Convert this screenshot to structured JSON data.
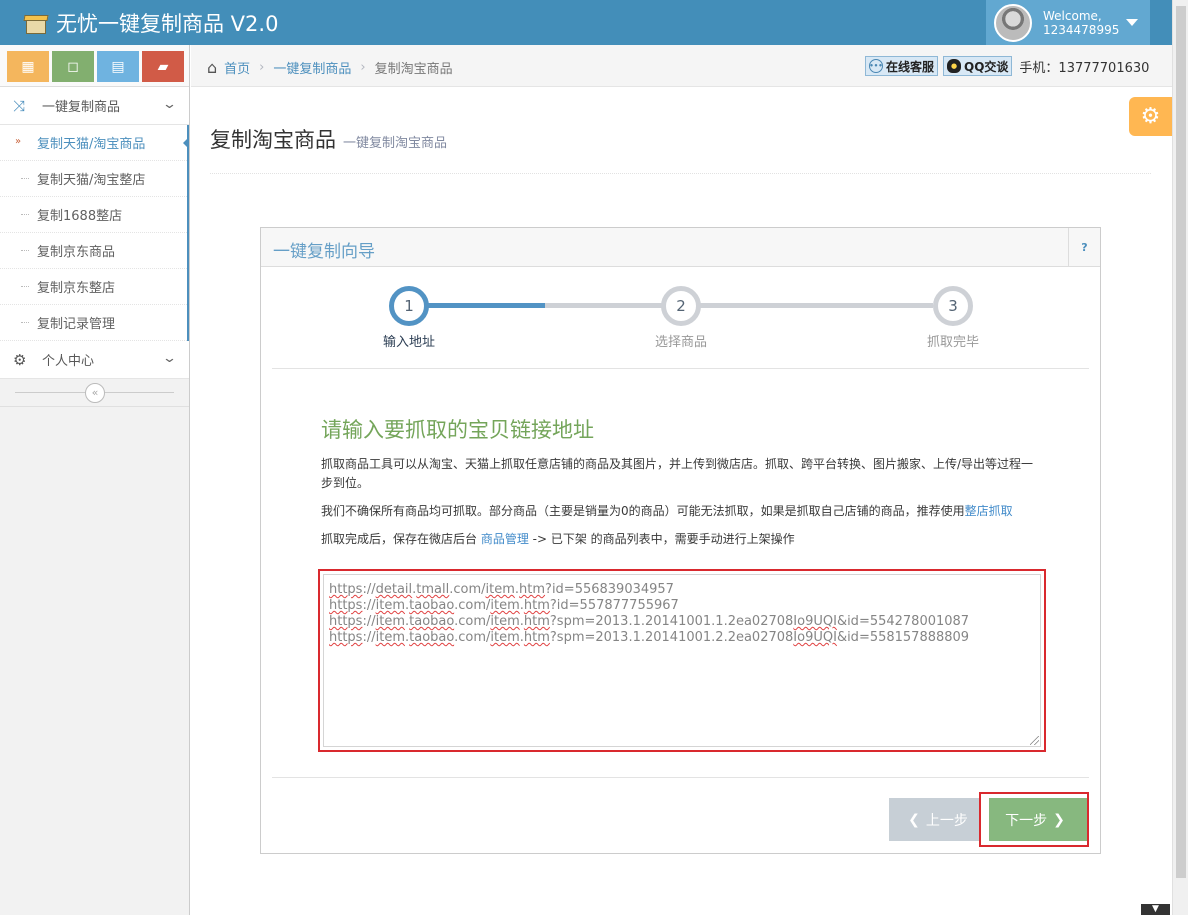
{
  "app": {
    "title": "无忧一键复制商品 V2.0"
  },
  "user": {
    "welcome": "Welcome,",
    "id": "1234478995"
  },
  "sidebar": {
    "shortcut_icons": [
      "calendar-icon",
      "square-icon",
      "grid-icon",
      "book-icon"
    ],
    "groups": [
      {
        "label": "一键复制商品",
        "icon": "shuffle-icon",
        "items": [
          {
            "label": "复制天猫/淘宝商品",
            "active": true
          },
          {
            "label": "复制天猫/淘宝整店"
          },
          {
            "label": "复制1688整店"
          },
          {
            "label": "复制京东商品"
          },
          {
            "label": "复制京东整店"
          },
          {
            "label": "复制记录管理"
          }
        ]
      },
      {
        "label": "个人中心",
        "icon": "gear-icon"
      }
    ]
  },
  "breadcrumb": {
    "home": "首页",
    "section": "一键复制商品",
    "current": "复制淘宝商品"
  },
  "contact": {
    "online": "在线客服",
    "qq": "QQ交谈",
    "phone": "手机：13777701630"
  },
  "page": {
    "title": "复制淘宝商品",
    "subtitle": "一键复制淘宝商品"
  },
  "widget": {
    "title": "一键复制向导",
    "help": "?",
    "steps": [
      {
        "num": "1",
        "label": "输入地址",
        "active": true
      },
      {
        "num": "2",
        "label": "选择商品",
        "active": false
      },
      {
        "num": "3",
        "label": "抓取完毕",
        "active": false
      }
    ],
    "content": {
      "heading": "请输入要抓取的宝贝链接地址",
      "p1": "抓取商品工具可以从淘宝、天猫上抓取任意店铺的商品及其图片，并上传到微店店。抓取、跨平台转换、图片搬家、上传/导出等过程一步到位。",
      "p2_text": "我们不确保所有商品均可抓取。部分商品（主要是销量为0的商品）可能无法抓取，如果是抓取自己店铺的商品，推荐使用",
      "p2_link": "整店抓取",
      "p3_pre": "抓取完成后，保存在微店后台 ",
      "p3_link": "商品管理",
      "p3_post": " -> 已下架 的商品列表中，需要手动进行上架操作"
    },
    "urls": [
      "https://detail.tmall.com/item.htm?id=556839034957",
      "https://item.taobao.com/item.htm?id=557877755967",
      "https://item.taobao.com/item.htm?spm=2013.1.20141001.1.2ea02708Io9UQI&id=554278001087",
      "https://item.taobao.com/item.htm?spm=2013.1.20141001.2.2ea02708Io9UQI&id=558157888809"
    ],
    "buttons": {
      "prev": "上一步",
      "next": "下一步"
    }
  }
}
